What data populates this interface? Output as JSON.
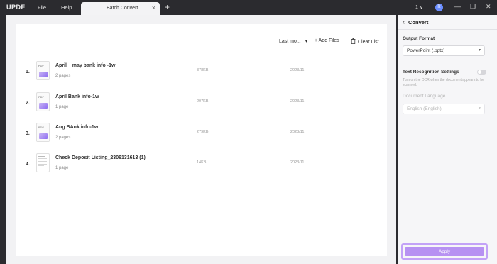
{
  "titlebar": {
    "logo": "UPDF",
    "menu": [
      "File",
      "Help"
    ],
    "tab_label": "Batch Convert",
    "tab_close": "×",
    "tab_add": "+",
    "page_indicator": "1 ∨",
    "avatar_letter": "R",
    "window_controls": [
      "—",
      "❐",
      "✕"
    ]
  },
  "toolbar": {
    "sort_label": "Last mo...",
    "sort_chevron": "▾",
    "add_files": "+ Add Files",
    "clear_list": "Clear List"
  },
  "files": [
    {
      "index": "1.",
      "thumb": "PDF",
      "name": "April _ may bank info -1w",
      "pages": "2 pages",
      "size": "378KB",
      "date": "2023/11"
    },
    {
      "index": "2.",
      "thumb": "PDF",
      "name": "April Bank info-1w",
      "pages": "1 page",
      "size": "207KB",
      "date": "2023/11"
    },
    {
      "index": "3.",
      "thumb": "PDF",
      "name": "Aug BAnk info-1w",
      "pages": "2 pages",
      "size": "279KB",
      "date": "2023/11"
    },
    {
      "index": "4.",
      "thumb": "",
      "name": "Check  Deposit Listing_2306131613 (1)",
      "pages": "1 page",
      "size": "14KB",
      "date": "2023/11"
    }
  ],
  "panel": {
    "back": "‹",
    "title": "Convert",
    "output_format_label": "Output Format",
    "output_format_value": "PowerPoint (.pptx)",
    "text_recognition_label": "Text Recognition Settings",
    "text_recognition_hint": "Turn on the OCR when the document appears to be scanned.",
    "document_language_label": "Document Language",
    "document_language_value": "English (English)",
    "apply": "Apply"
  },
  "colors": {
    "accent": "#b791f2",
    "accent_border": "#c3a2f7",
    "titlebar_bg": "#2b2b2f"
  }
}
